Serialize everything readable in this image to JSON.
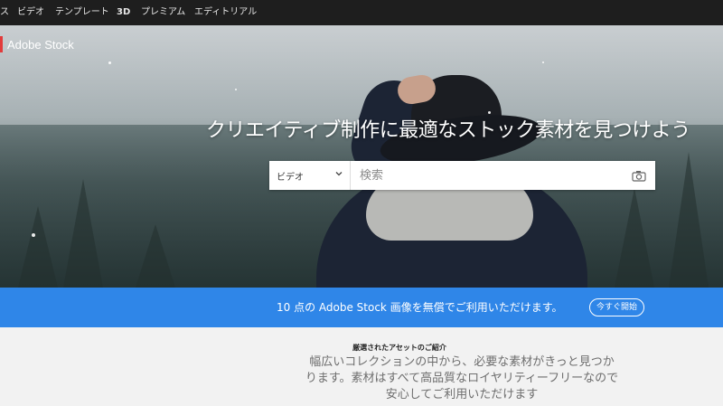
{
  "nav": {
    "items": [
      "ス",
      "ビデオ",
      "テンプレート",
      "3D",
      "プレミアム",
      "エディトリアル"
    ]
  },
  "brand": {
    "name": "Adobe Stock",
    "accent": "#e23b3b"
  },
  "hero": {
    "headline": "クリエイティブ制作に最適なストック素材を見つけよう",
    "search": {
      "type_selected": "ビデオ",
      "placeholder": "検索",
      "camera_icon": "camera-icon",
      "chevron_icon": "chevron-down-icon"
    }
  },
  "promo": {
    "message": "10 点の Adobe Stock 画像を無償でご利用いただけます。",
    "button_label": "今すぐ開始",
    "color": "#2f86e8"
  },
  "featured": {
    "heading": "厳選されたアセットのご紹介",
    "description": "幅広いコレクションの中から、必要な素材がきっと見つかります。素材はすべて高品質なロイヤリティーフリーなので安心してご利用いただけます"
  }
}
